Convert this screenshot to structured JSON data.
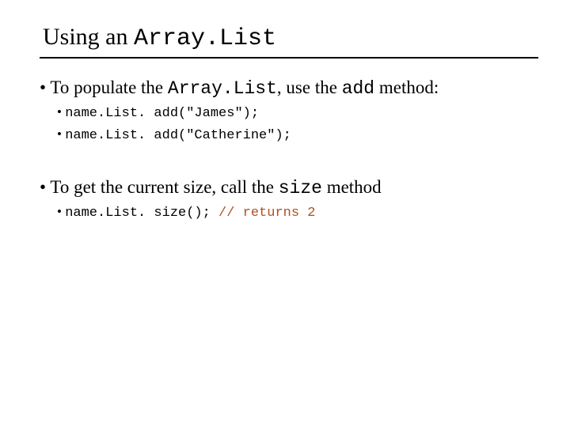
{
  "title": {
    "prefix": "Using an ",
    "code": "Array.List"
  },
  "section1": {
    "line": {
      "p1": "To populate the ",
      "c1": "Array.List",
      "p2": ", use the ",
      "c2": "add",
      "p3": " method:"
    },
    "code1": "name.List. add(\"James\");",
    "code2": "name.List. add(\"Catherine\");"
  },
  "section2": {
    "line": {
      "p1": "To get the current size, call the ",
      "c1": "size",
      "p2": " method"
    },
    "code_prefix": "name.List. size();   ",
    "code_comment": "// returns 2"
  }
}
